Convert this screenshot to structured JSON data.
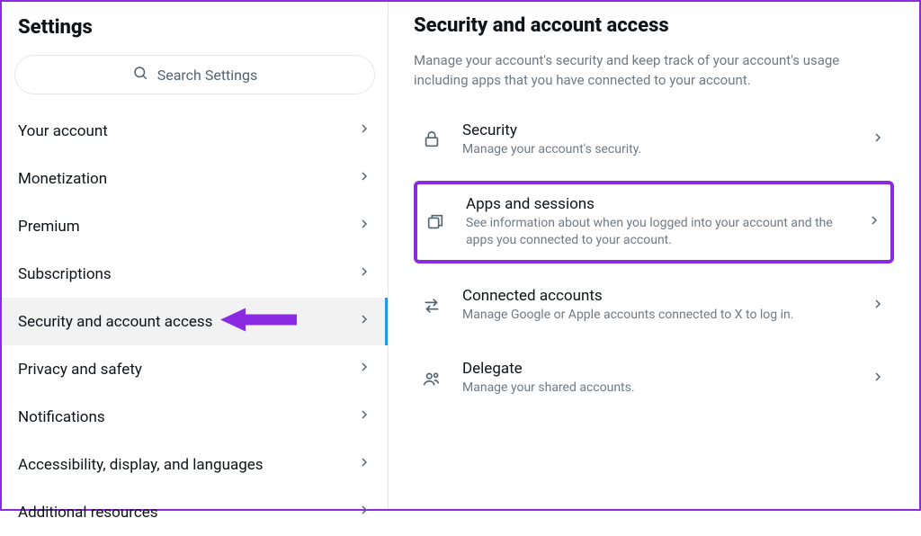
{
  "sidebar": {
    "title": "Settings",
    "search_placeholder": "Search Settings",
    "items": [
      {
        "label": "Your account"
      },
      {
        "label": "Monetization"
      },
      {
        "label": "Premium"
      },
      {
        "label": "Subscriptions"
      },
      {
        "label": "Security and account access"
      },
      {
        "label": "Privacy and safety"
      },
      {
        "label": "Notifications"
      },
      {
        "label": "Accessibility, display, and languages"
      },
      {
        "label": "Additional resources"
      }
    ],
    "active_index": 4
  },
  "main": {
    "title": "Security and account access",
    "description": "Manage your account's security and keep track of your account's usage including apps that you have connected to your account.",
    "options": [
      {
        "icon": "lock",
        "title": "Security",
        "subtitle": "Manage your account's security."
      },
      {
        "icon": "apps",
        "title": "Apps and sessions",
        "subtitle": "See information about when you logged into your account and the apps you connected to your account."
      },
      {
        "icon": "swap",
        "title": "Connected accounts",
        "subtitle": "Manage Google or Apple accounts connected to X to log in."
      },
      {
        "icon": "people",
        "title": "Delegate",
        "subtitle": "Manage your shared accounts."
      }
    ],
    "highlight_index": 1
  },
  "annotations": {
    "arrow_color": "#8a2be2",
    "highlight_color": "#8a2be2"
  }
}
